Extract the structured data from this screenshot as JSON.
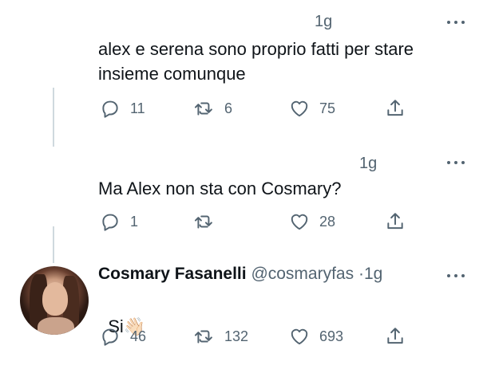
{
  "tweets": [
    {
      "time": "1g",
      "text": "alex e serena sono proprio fatti per stare\ninsieme comunque",
      "replies": "11",
      "retweets": "6",
      "likes": "75"
    },
    {
      "time": "1g",
      "text": "Ma Alex non sta con Cosmary?",
      "replies": "1",
      "retweets": "",
      "likes": "28"
    },
    {
      "author_name": "Cosmary Fasanelli",
      "author_handle": "@cosmaryfas",
      "separator": "·",
      "time": "1g",
      "text": "Si",
      "emoji": "👋🏻",
      "replies": "46",
      "retweets": "132",
      "likes": "693"
    }
  ],
  "icons": {
    "reply": "reply-icon",
    "retweet": "retweet-icon",
    "like": "heart-icon",
    "share": "share-icon",
    "more": "more-icon"
  },
  "colors": {
    "text": "#0f1419",
    "secondary": "#536471",
    "thread_line": "#cfd9de"
  }
}
